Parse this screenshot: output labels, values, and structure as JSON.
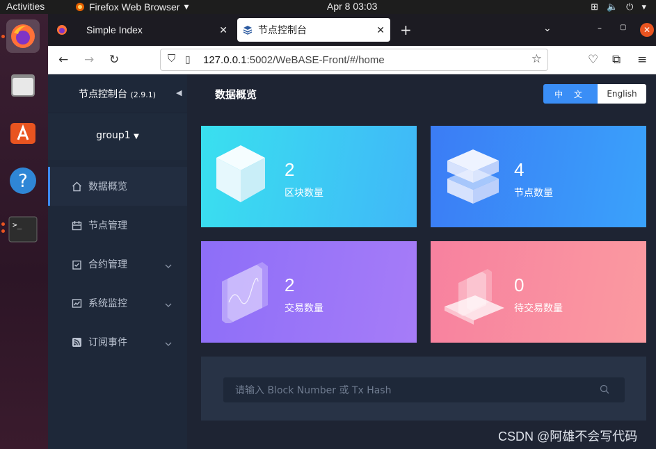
{
  "os": {
    "activities": "Activities",
    "app_name": "Firefox Web Browser",
    "clock": "Apr 8  03:03"
  },
  "browser": {
    "tabs": [
      {
        "label": "Simple Index"
      },
      {
        "label": "节点控制台"
      }
    ],
    "url_host": "127.0.0.1",
    "url_rest": ":5002/WeBASE-Front/#/home"
  },
  "sidebar": {
    "title": "节点控制台",
    "version": "(2.9.1)",
    "group": "group1",
    "items": [
      {
        "label": "数据概览"
      },
      {
        "label": "节点管理"
      },
      {
        "label": "合约管理"
      },
      {
        "label": "系统监控"
      },
      {
        "label": "订阅事件"
      }
    ]
  },
  "main": {
    "title": "数据概览",
    "lang_zh": "中 文",
    "lang_en": "English",
    "cards": [
      {
        "value": "2",
        "label": "区块数量"
      },
      {
        "value": "4",
        "label": "节点数量"
      },
      {
        "value": "2",
        "label": "交易数量"
      },
      {
        "value": "0",
        "label": "待交易数量"
      }
    ],
    "search_placeholder": "请输入 Block Number 或 Tx Hash"
  },
  "watermark": "CSDN @阿雄不会写代码"
}
